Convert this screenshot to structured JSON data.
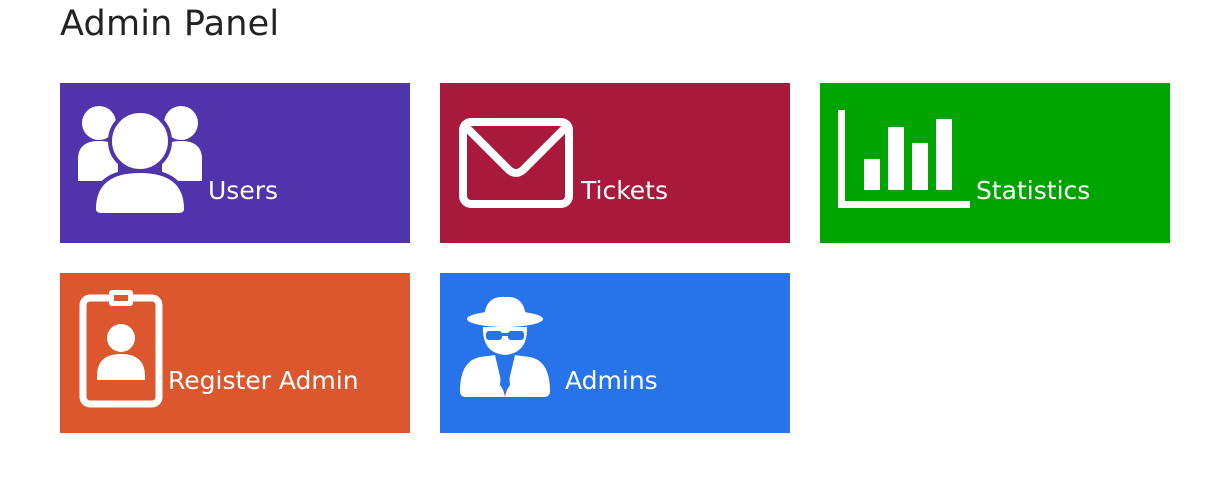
{
  "page": {
    "title": "Admin Panel"
  },
  "tiles": [
    {
      "id": "users",
      "label": "Users",
      "icon": "users-group-icon",
      "color": "#5034ac"
    },
    {
      "id": "tickets",
      "label": "Tickets",
      "icon": "envelope-icon",
      "color": "#a8193c"
    },
    {
      "id": "statistics",
      "label": "Statistics",
      "icon": "bar-chart-icon",
      "color": "#00a400"
    },
    {
      "id": "register_admin",
      "label": "Register Admin",
      "icon": "id-badge-icon",
      "color": "#dc572e"
    },
    {
      "id": "admins",
      "label": "Admins",
      "icon": "spy-agent-icon",
      "color": "#2774ea"
    }
  ]
}
